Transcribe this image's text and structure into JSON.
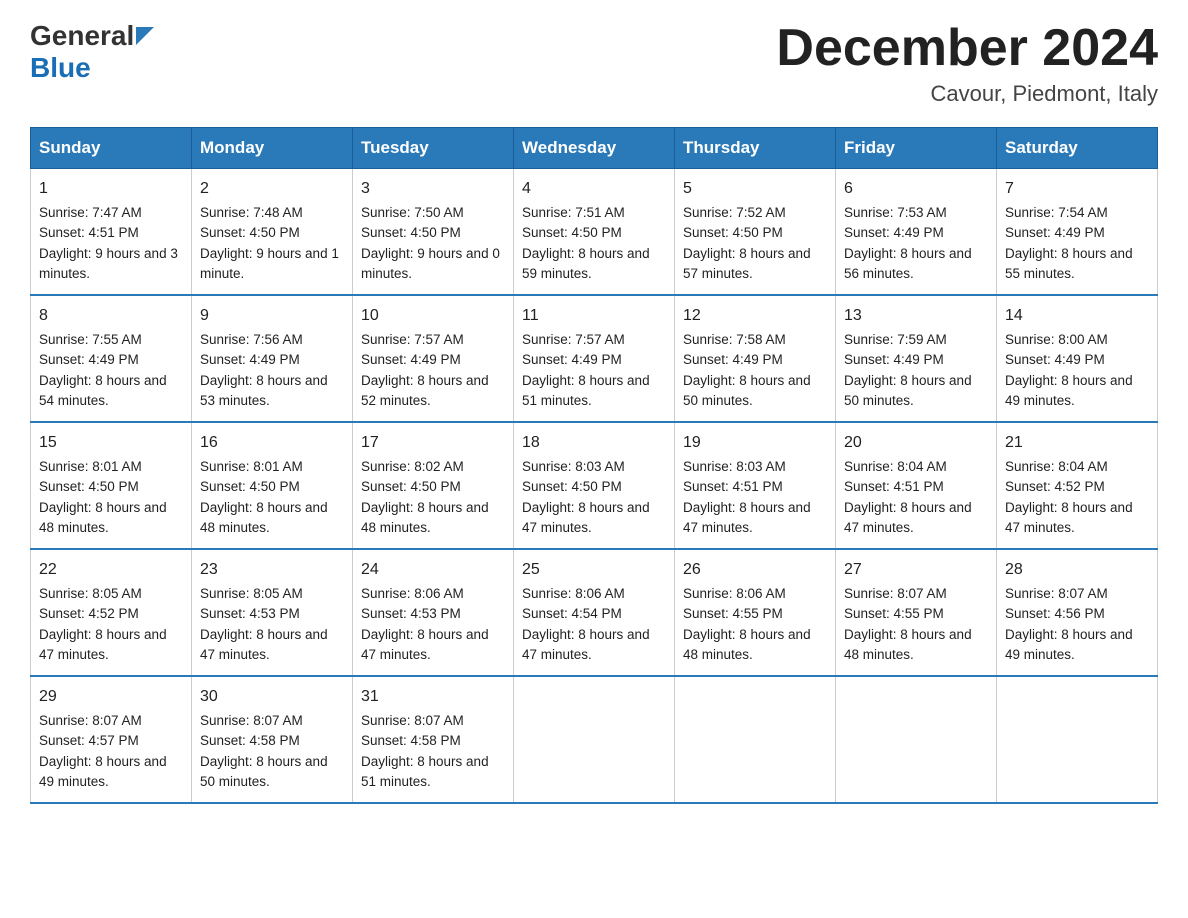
{
  "header": {
    "logo_line1": "General",
    "logo_line2": "Blue",
    "month_title": "December 2024",
    "location": "Cavour, Piedmont, Italy"
  },
  "days_of_week": [
    "Sunday",
    "Monday",
    "Tuesday",
    "Wednesday",
    "Thursday",
    "Friday",
    "Saturday"
  ],
  "weeks": [
    [
      {
        "day": "1",
        "sunrise": "7:47 AM",
        "sunset": "4:51 PM",
        "daylight": "9 hours and 3 minutes."
      },
      {
        "day": "2",
        "sunrise": "7:48 AM",
        "sunset": "4:50 PM",
        "daylight": "9 hours and 1 minute."
      },
      {
        "day": "3",
        "sunrise": "7:50 AM",
        "sunset": "4:50 PM",
        "daylight": "9 hours and 0 minutes."
      },
      {
        "day": "4",
        "sunrise": "7:51 AM",
        "sunset": "4:50 PM",
        "daylight": "8 hours and 59 minutes."
      },
      {
        "day": "5",
        "sunrise": "7:52 AM",
        "sunset": "4:50 PM",
        "daylight": "8 hours and 57 minutes."
      },
      {
        "day": "6",
        "sunrise": "7:53 AM",
        "sunset": "4:49 PM",
        "daylight": "8 hours and 56 minutes."
      },
      {
        "day": "7",
        "sunrise": "7:54 AM",
        "sunset": "4:49 PM",
        "daylight": "8 hours and 55 minutes."
      }
    ],
    [
      {
        "day": "8",
        "sunrise": "7:55 AM",
        "sunset": "4:49 PM",
        "daylight": "8 hours and 54 minutes."
      },
      {
        "day": "9",
        "sunrise": "7:56 AM",
        "sunset": "4:49 PM",
        "daylight": "8 hours and 53 minutes."
      },
      {
        "day": "10",
        "sunrise": "7:57 AM",
        "sunset": "4:49 PM",
        "daylight": "8 hours and 52 minutes."
      },
      {
        "day": "11",
        "sunrise": "7:57 AM",
        "sunset": "4:49 PM",
        "daylight": "8 hours and 51 minutes."
      },
      {
        "day": "12",
        "sunrise": "7:58 AM",
        "sunset": "4:49 PM",
        "daylight": "8 hours and 50 minutes."
      },
      {
        "day": "13",
        "sunrise": "7:59 AM",
        "sunset": "4:49 PM",
        "daylight": "8 hours and 50 minutes."
      },
      {
        "day": "14",
        "sunrise": "8:00 AM",
        "sunset": "4:49 PM",
        "daylight": "8 hours and 49 minutes."
      }
    ],
    [
      {
        "day": "15",
        "sunrise": "8:01 AM",
        "sunset": "4:50 PM",
        "daylight": "8 hours and 48 minutes."
      },
      {
        "day": "16",
        "sunrise": "8:01 AM",
        "sunset": "4:50 PM",
        "daylight": "8 hours and 48 minutes."
      },
      {
        "day": "17",
        "sunrise": "8:02 AM",
        "sunset": "4:50 PM",
        "daylight": "8 hours and 48 minutes."
      },
      {
        "day": "18",
        "sunrise": "8:03 AM",
        "sunset": "4:50 PM",
        "daylight": "8 hours and 47 minutes."
      },
      {
        "day": "19",
        "sunrise": "8:03 AM",
        "sunset": "4:51 PM",
        "daylight": "8 hours and 47 minutes."
      },
      {
        "day": "20",
        "sunrise": "8:04 AM",
        "sunset": "4:51 PM",
        "daylight": "8 hours and 47 minutes."
      },
      {
        "day": "21",
        "sunrise": "8:04 AM",
        "sunset": "4:52 PM",
        "daylight": "8 hours and 47 minutes."
      }
    ],
    [
      {
        "day": "22",
        "sunrise": "8:05 AM",
        "sunset": "4:52 PM",
        "daylight": "8 hours and 47 minutes."
      },
      {
        "day": "23",
        "sunrise": "8:05 AM",
        "sunset": "4:53 PM",
        "daylight": "8 hours and 47 minutes."
      },
      {
        "day": "24",
        "sunrise": "8:06 AM",
        "sunset": "4:53 PM",
        "daylight": "8 hours and 47 minutes."
      },
      {
        "day": "25",
        "sunrise": "8:06 AM",
        "sunset": "4:54 PM",
        "daylight": "8 hours and 47 minutes."
      },
      {
        "day": "26",
        "sunrise": "8:06 AM",
        "sunset": "4:55 PM",
        "daylight": "8 hours and 48 minutes."
      },
      {
        "day": "27",
        "sunrise": "8:07 AM",
        "sunset": "4:55 PM",
        "daylight": "8 hours and 48 minutes."
      },
      {
        "day": "28",
        "sunrise": "8:07 AM",
        "sunset": "4:56 PM",
        "daylight": "8 hours and 49 minutes."
      }
    ],
    [
      {
        "day": "29",
        "sunrise": "8:07 AM",
        "sunset": "4:57 PM",
        "daylight": "8 hours and 49 minutes."
      },
      {
        "day": "30",
        "sunrise": "8:07 AM",
        "sunset": "4:58 PM",
        "daylight": "8 hours and 50 minutes."
      },
      {
        "day": "31",
        "sunrise": "8:07 AM",
        "sunset": "4:58 PM",
        "daylight": "8 hours and 51 minutes."
      },
      null,
      null,
      null,
      null
    ]
  ],
  "labels": {
    "sunrise": "Sunrise:",
    "sunset": "Sunset:",
    "daylight": "Daylight:"
  }
}
